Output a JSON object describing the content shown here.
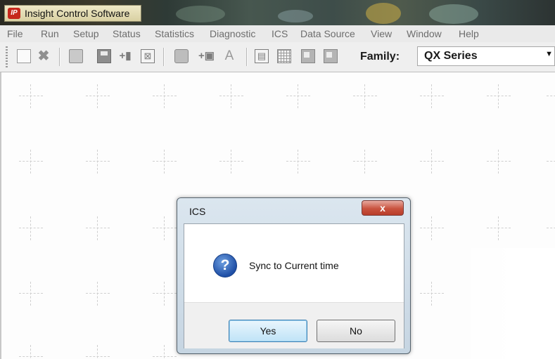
{
  "app": {
    "title": "Insight Control Software",
    "icon_text": "IP"
  },
  "menu": [
    "File",
    "Run",
    "Setup",
    "Status",
    "Statistics",
    "Diagnostic",
    "ICS",
    "Data Source",
    "View",
    "Window",
    "Help"
  ],
  "toolbar": {
    "icons": [
      "new-document-icon",
      "delete-icon",
      "open-folder-icon",
      "save-icon",
      "add-icon",
      "export-icon",
      "print-icon",
      "add-record-icon",
      "font-icon",
      "layout-icon",
      "grid-icon",
      "window-icon",
      "tile-icon"
    ],
    "family_label": "Family:",
    "family_value": "QX Series"
  },
  "dialog": {
    "title": "ICS",
    "close_glyph": "x",
    "message": "Sync to Current time",
    "icon": "question-icon",
    "yes_label": "Yes",
    "no_label": "No"
  }
}
